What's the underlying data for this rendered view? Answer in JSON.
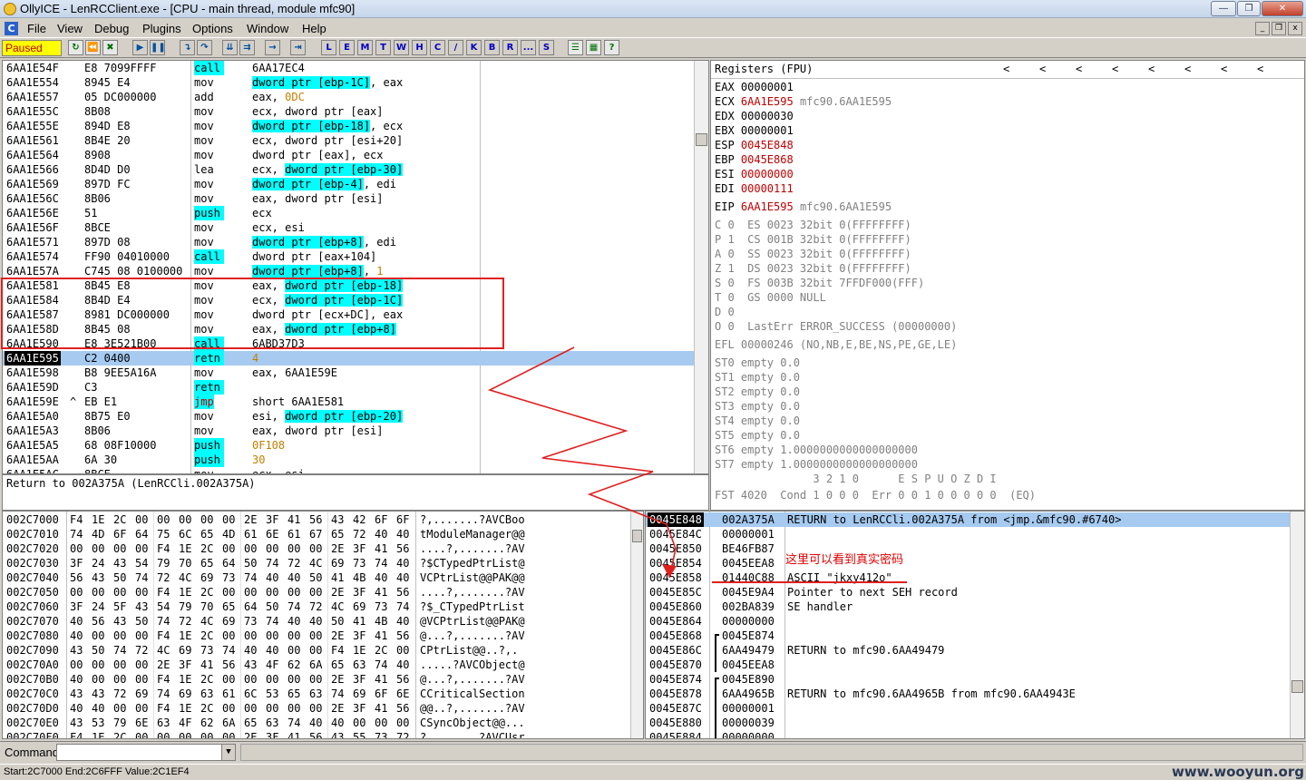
{
  "window": {
    "title": "OllyICE - LenRCClient.exe - [CPU - main thread, module mfc90]"
  },
  "menu": [
    "File",
    "View",
    "Debug",
    "Plugins",
    "Options",
    "Window",
    "Help"
  ],
  "toolbar": {
    "status": "Paused",
    "letters": [
      "L",
      "E",
      "M",
      "T",
      "W",
      "H",
      "C",
      "/",
      "K",
      "B",
      "R",
      "...",
      "S"
    ]
  },
  "disasm": [
    {
      "addr": "6AA1E54F",
      "hex": "E8 7099FFFF",
      "mn": "call",
      "op": "6AA17EC4",
      "mc": 1
    },
    {
      "addr": "6AA1E554",
      "hex": "8945 E4",
      "mn": "mov",
      "op1": "dword ptr [ebp-1C]",
      "op2": ", eax"
    },
    {
      "addr": "6AA1E557",
      "hex": "05 DC000000",
      "mn": "add",
      "op": "eax, ",
      "imm": "0DC"
    },
    {
      "addr": "6AA1E55C",
      "hex": "8B08",
      "mn": "mov",
      "op": "ecx, dword ptr [eax]"
    },
    {
      "addr": "6AA1E55E",
      "hex": "894D E8",
      "mn": "mov",
      "op1": "dword ptr [ebp-18]",
      "op2": ", ecx"
    },
    {
      "addr": "6AA1E561",
      "hex": "8B4E 20",
      "mn": "mov",
      "op": "ecx, dword ptr [esi+20]"
    },
    {
      "addr": "6AA1E564",
      "hex": "8908",
      "mn": "mov",
      "op": "dword ptr [eax], ecx"
    },
    {
      "addr": "6AA1E566",
      "hex": "8D4D D0",
      "mn": "lea",
      "pre": "ecx, ",
      "op1": "dword ptr [ebp-30]"
    },
    {
      "addr": "6AA1E569",
      "hex": "897D FC",
      "mn": "mov",
      "op1": "dword ptr [ebp-4]",
      "op2": ", edi"
    },
    {
      "addr": "6AA1E56C",
      "hex": "8B06",
      "mn": "mov",
      "op": "eax, dword ptr [esi]"
    },
    {
      "addr": "6AA1E56E",
      "hex": "51",
      "mn": "push",
      "op": "ecx",
      "mc": 2
    },
    {
      "addr": "6AA1E56F",
      "hex": "8BCE",
      "mn": "mov",
      "op": "ecx, esi"
    },
    {
      "addr": "6AA1E571",
      "hex": "897D 08",
      "mn": "mov",
      "op1": "dword ptr [ebp+8]",
      "op2": ", edi"
    },
    {
      "addr": "6AA1E574",
      "hex": "FF90 04010000",
      "mn": "call",
      "op": "dword ptr [eax+104]",
      "mc": 1
    },
    {
      "addr": "6AA1E57A",
      "hex": "C745 08 0100000",
      "mn": "mov",
      "op1": "dword ptr [ebp+8]",
      "op2": ", ",
      "imm": "1"
    },
    {
      "addr": "6AA1E581",
      "hex": "8B45 E8",
      "mn": "mov",
      "pre": "eax, ",
      "op1": "dword ptr [ebp-18]"
    },
    {
      "addr": "6AA1E584",
      "hex": "8B4D E4",
      "mn": "mov",
      "pre": "ecx, ",
      "op1": "dword ptr [ebp-1C]"
    },
    {
      "addr": "6AA1E587",
      "hex": "8981 DC000000",
      "mn": "mov",
      "op": "dword ptr [ecx+DC], eax"
    },
    {
      "addr": "6AA1E58D",
      "hex": "8B45 08",
      "mn": "mov",
      "pre": "eax, ",
      "op1": "dword ptr [ebp+8]"
    },
    {
      "addr": "6AA1E590",
      "hex": "E8 3E521B00",
      "mn": "call",
      "op": "6ABD37D3",
      "mc": 1
    },
    {
      "addr": "6AA1E595",
      "hex": "C2 0400",
      "mn": "retn",
      "op": "",
      "imm": "4",
      "mc": 1,
      "cur": 1
    },
    {
      "addr": "6AA1E598",
      "hex": "B8 9EE5A16A",
      "mn": "mov",
      "op": "eax, 6AA1E59E"
    },
    {
      "addr": "6AA1E59D",
      "hex": "C3",
      "mn": "retn",
      "op": "",
      "mc": 1
    },
    {
      "addr": "6AA1E59E",
      "mark": "^",
      "hex": "EB E1",
      "mn": "jmp",
      "op": "short 6AA1E581",
      "mc": 3
    },
    {
      "addr": "6AA1E5A0",
      "hex": "8B75 E0",
      "mn": "mov",
      "pre": "esi, ",
      "op1": "dword ptr [ebp-20]"
    },
    {
      "addr": "6AA1E5A3",
      "hex": "8B06",
      "mn": "mov",
      "op": "eax, dword ptr [esi]"
    },
    {
      "addr": "6AA1E5A5",
      "hex": "68 08F10000",
      "mn": "push",
      "imm": "0F108",
      "op": "",
      "mc": 2
    },
    {
      "addr": "6AA1E5AA",
      "hex": "6A 30",
      "mn": "push",
      "imm": "30",
      "op": "",
      "mc": 2
    },
    {
      "addr": "6AA1E5AC",
      "hex": "8BCE",
      "mn": "mov",
      "op": "ecx, esi"
    }
  ],
  "info": "Return to 002A375A (LenRCCli.002A375A)",
  "registers": {
    "header": "Registers (FPU)",
    "gpr": [
      {
        "n": "EAX",
        "v": "00000001",
        "x": "",
        "r": 0
      },
      {
        "n": "ECX",
        "v": "6AA1E595",
        "x": "mfc90.6AA1E595",
        "r": 1
      },
      {
        "n": "EDX",
        "v": "00000030",
        "x": "",
        "r": 0
      },
      {
        "n": "EBX",
        "v": "00000001",
        "x": "",
        "r": 0
      },
      {
        "n": "ESP",
        "v": "0045E848",
        "x": "",
        "r": 1
      },
      {
        "n": "EBP",
        "v": "0045E868",
        "x": "",
        "r": 1
      },
      {
        "n": "ESI",
        "v": "00000000",
        "x": "",
        "r": 1
      },
      {
        "n": "EDI",
        "v": "00000111",
        "x": "",
        "r": 1
      }
    ],
    "eip": {
      "n": "EIP",
      "v": "6AA1E595",
      "x": "mfc90.6AA1E595"
    },
    "flags": [
      "C 0  ES 0023 32bit 0(FFFFFFFF)",
      "P 1  CS 001B 32bit 0(FFFFFFFF)",
      "A 0  SS 0023 32bit 0(FFFFFFFF)",
      "Z 1  DS 0023 32bit 0(FFFFFFFF)",
      "S 0  FS 003B 32bit 7FFDF000(FFF)",
      "T 0  GS 0000 NULL",
      "D 0",
      "O 0  LastErr ERROR_SUCCESS (00000000)"
    ],
    "efl": "EFL 00000246 (NO,NB,E,BE,NS,PE,GE,LE)",
    "fpu": [
      "ST0 empty 0.0",
      "ST1 empty 0.0",
      "ST2 empty 0.0",
      "ST3 empty 0.0",
      "ST4 empty 0.0",
      "ST5 empty 0.0",
      "ST6 empty 1.0000000000000000000",
      "ST7 empty 1.0000000000000000000"
    ],
    "fpu_bits": "               3 2 1 0      E S P U O Z D I",
    "fst": "FST 4020  Cond 1 0 0 0  Err 0 0 1 0 0 0 0 0  (EQ)"
  },
  "dump": [
    {
      "a": "002C7000",
      "h": [
        "F4",
        "1E",
        "2C",
        "00",
        "00",
        "00",
        "00",
        "00",
        "2E",
        "3F",
        "41",
        "56",
        "43",
        "42",
        "6F",
        "6F"
      ],
      "t": "?,.......?AVCBoo"
    },
    {
      "a": "002C7010",
      "h": [
        "74",
        "4D",
        "6F",
        "64",
        "75",
        "6C",
        "65",
        "4D",
        "61",
        "6E",
        "61",
        "67",
        "65",
        "72",
        "40",
        "40"
      ],
      "t": "tModuleManager@@"
    },
    {
      "a": "002C7020",
      "h": [
        "00",
        "00",
        "00",
        "00",
        "F4",
        "1E",
        "2C",
        "00",
        "00",
        "00",
        "00",
        "00",
        "2E",
        "3F",
        "41",
        "56"
      ],
      "t": "....?,.......?AV"
    },
    {
      "a": "002C7030",
      "h": [
        "3F",
        "24",
        "43",
        "54",
        "79",
        "70",
        "65",
        "64",
        "50",
        "74",
        "72",
        "4C",
        "69",
        "73",
        "74",
        "40"
      ],
      "t": "?$CTypedPtrList@"
    },
    {
      "a": "002C7040",
      "h": [
        "56",
        "43",
        "50",
        "74",
        "72",
        "4C",
        "69",
        "73",
        "74",
        "40",
        "40",
        "50",
        "41",
        "4B",
        "40",
        "40"
      ],
      "t": "VCPtrList@@PAK@@"
    },
    {
      "a": "002C7050",
      "h": [
        "00",
        "00",
        "00",
        "00",
        "F4",
        "1E",
        "2C",
        "00",
        "00",
        "00",
        "00",
        "00",
        "2E",
        "3F",
        "41",
        "56"
      ],
      "t": "....?,.......?AV"
    },
    {
      "a": "002C7060",
      "h": [
        "3F",
        "24",
        "5F",
        "43",
        "54",
        "79",
        "70",
        "65",
        "64",
        "50",
        "74",
        "72",
        "4C",
        "69",
        "73",
        "74"
      ],
      "t": "?$_CTypedPtrList"
    },
    {
      "a": "002C7070",
      "h": [
        "40",
        "56",
        "43",
        "50",
        "74",
        "72",
        "4C",
        "69",
        "73",
        "74",
        "40",
        "40",
        "50",
        "41",
        "4B",
        "40"
      ],
      "t": "@VCPtrList@@PAK@"
    },
    {
      "a": "002C7080",
      "h": [
        "40",
        "00",
        "00",
        "00",
        "F4",
        "1E",
        "2C",
        "00",
        "00",
        "00",
        "00",
        "00",
        "2E",
        "3F",
        "41",
        "56"
      ],
      "t": "@...?,.......?AV"
    },
    {
      "a": "002C7090",
      "h": [
        "43",
        "50",
        "74",
        "72",
        "4C",
        "69",
        "73",
        "74",
        "40",
        "40",
        "00",
        "00",
        "F4",
        "1E",
        "2C",
        "00"
      ],
      "t": "CPtrList@@..?,."
    },
    {
      "a": "002C70A0",
      "h": [
        "00",
        "00",
        "00",
        "00",
        "2E",
        "3F",
        "41",
        "56",
        "43",
        "4F",
        "62",
        "6A",
        "65",
        "63",
        "74",
        "40"
      ],
      "t": ".....?AVCObject@"
    },
    {
      "a": "002C70B0",
      "h": [
        "40",
        "00",
        "00",
        "00",
        "F4",
        "1E",
        "2C",
        "00",
        "00",
        "00",
        "00",
        "00",
        "2E",
        "3F",
        "41",
        "56"
      ],
      "t": "@...?,.......?AV"
    },
    {
      "a": "002C70C0",
      "h": [
        "43",
        "43",
        "72",
        "69",
        "74",
        "69",
        "63",
        "61",
        "6C",
        "53",
        "65",
        "63",
        "74",
        "69",
        "6F",
        "6E"
      ],
      "t": "CCriticalSection"
    },
    {
      "a": "002C70D0",
      "h": [
        "40",
        "40",
        "00",
        "00",
        "F4",
        "1E",
        "2C",
        "00",
        "00",
        "00",
        "00",
        "00",
        "2E",
        "3F",
        "41",
        "56"
      ],
      "t": "@@..?,.......?AV"
    },
    {
      "a": "002C70E0",
      "h": [
        "43",
        "53",
        "79",
        "6E",
        "63",
        "4F",
        "62",
        "6A",
        "65",
        "63",
        "74",
        "40",
        "40",
        "00",
        "00",
        "00"
      ],
      "t": "CSyncObject@@..."
    },
    {
      "a": "002C70F0",
      "h": [
        "F4",
        "1E",
        "2C",
        "00",
        "00",
        "00",
        "00",
        "00",
        "2E",
        "3F",
        "41",
        "56",
        "43",
        "55",
        "73",
        "72"
      ],
      "t": "?,.......?AVCUsr"
    }
  ],
  "stack": [
    {
      "a": "0045E848",
      "v": "002A375A",
      "c": "RETURN to LenRCCli.002A375A from <jmp.&mfc90.#6740>",
      "cur": 1
    },
    {
      "a": "0045E84C",
      "v": "00000001",
      "c": ""
    },
    {
      "a": "0045E850",
      "v": "BE46FB87",
      "c": ""
    },
    {
      "a": "0045E854",
      "v": "0045EEA8",
      "c": ""
    },
    {
      "a": "0045E858",
      "v": "01440C88",
      "c": "ASCII \"jkxy412o\""
    },
    {
      "a": "0045E85C",
      "v": "0045E9A4",
      "c": "Pointer to next SEH record"
    },
    {
      "a": "0045E860",
      "v": "002BA839",
      "c": "SE handler"
    },
    {
      "a": "0045E864",
      "v": "00000000",
      "c": ""
    },
    {
      "a": "0045E868",
      "v": "0045E874",
      "c": "",
      "br": "top"
    },
    {
      "a": "0045E86C",
      "v": "6AA49479",
      "c": "RETURN to mfc90.6AA49479",
      "br": "mid"
    },
    {
      "a": "0045E870",
      "v": "0045EEA8",
      "c": "",
      "br": "mid"
    },
    {
      "a": "0045E874",
      "v": "0045E890",
      "c": "",
      "br": "top"
    },
    {
      "a": "0045E878",
      "v": "6AA4965B",
      "c": "RETURN to mfc90.6AA4965B from mfc90.6AA4943E",
      "br": "mid"
    },
    {
      "a": "0045E87C",
      "v": "00000001",
      "c": "",
      "br": "mid"
    },
    {
      "a": "0045E880",
      "v": "00000039",
      "c": "",
      "br": "mid"
    },
    {
      "a": "0045E884",
      "v": "00000000",
      "c": "",
      "br": "mid"
    }
  ],
  "annotation": {
    "text": "这里可以看到真实密码",
    "color": "#e00000"
  },
  "command": {
    "label": "Command",
    "value": ""
  },
  "status": "Start:2C7000 End:2C6FFF Value:2C1EF4",
  "watermark": "www.wooyun.org"
}
